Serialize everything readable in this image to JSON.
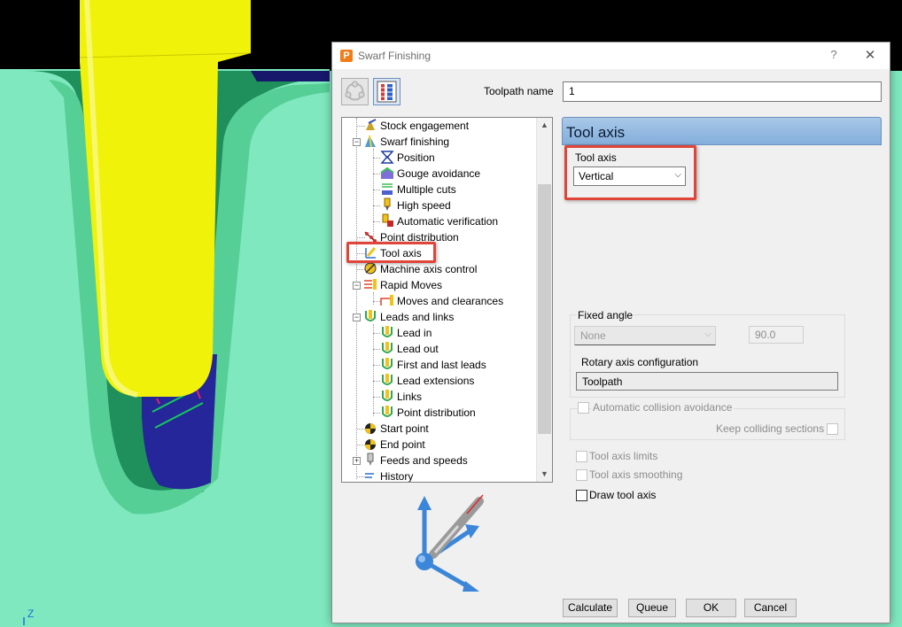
{
  "colors": {
    "viewport_background": "#7fe8bf",
    "tool_yellow": "#f1f20a",
    "cavity_blue": "#25269a",
    "highlight_red": "#e0453a",
    "header_blue": "#8fb5de"
  },
  "viewport": {
    "axis_label": "Z"
  },
  "dialog": {
    "title": "Swarf Finishing",
    "help_label": "?",
    "close_label": "✕",
    "toolpath_name_label": "Toolpath name",
    "toolpath_name_value": "1"
  },
  "tree": [
    {
      "label": "Stock engagement",
      "icon": "stock-engagement-icon"
    },
    {
      "label": "Swarf finishing",
      "icon": "swarf-finishing-icon"
    },
    {
      "label": "Position",
      "icon": "position-icon"
    },
    {
      "label": "Gouge avoidance",
      "icon": "gouge-avoidance-icon"
    },
    {
      "label": "Multiple cuts",
      "icon": "multiple-cuts-icon"
    },
    {
      "label": "High speed",
      "icon": "high-speed-icon"
    },
    {
      "label": "Automatic verification",
      "icon": "automatic-verification-icon"
    },
    {
      "label": "Point distribution",
      "icon": "point-distribution-icon"
    },
    {
      "label": "Tool axis",
      "icon": "tool-axis-icon"
    },
    {
      "label": "Machine axis control",
      "icon": "machine-axis-control-icon"
    },
    {
      "label": "Rapid Moves",
      "icon": "rapid-moves-icon"
    },
    {
      "label": "Moves and clearances",
      "icon": "moves-clearances-icon"
    },
    {
      "label": "Leads and links",
      "icon": "leads-links-icon"
    },
    {
      "label": "Lead in",
      "icon": "lead-in-icon"
    },
    {
      "label": "Lead out",
      "icon": "lead-out-icon"
    },
    {
      "label": "First and last leads",
      "icon": "first-last-leads-icon"
    },
    {
      "label": "Lead extensions",
      "icon": "lead-extensions-icon"
    },
    {
      "label": "Links",
      "icon": "links-icon"
    },
    {
      "label": "Point distribution",
      "icon": "point-distribution-icon"
    },
    {
      "label": "Start point",
      "icon": "start-point-icon"
    },
    {
      "label": "End point",
      "icon": "end-point-icon"
    },
    {
      "label": "Feeds and speeds",
      "icon": "feeds-speeds-icon"
    },
    {
      "label": "History",
      "icon": "history-icon"
    }
  ],
  "panel": {
    "title": "Tool axis",
    "tool_axis_label": "Tool axis",
    "tool_axis_value": "Vertical",
    "fixed_angle_label": "Fixed angle",
    "fixed_angle_value": "None",
    "angle_value": "90.0",
    "rotary_label": "Rotary axis configuration",
    "rotary_value": "Toolpath",
    "auto_collision_label": "Automatic collision avoidance",
    "keep_colliding_label": "Keep colliding sections",
    "tool_axis_limits_label": "Tool axis limits",
    "tool_axis_smoothing_label": "Tool axis smoothing",
    "draw_tool_axis_label": "Draw tool axis"
  },
  "buttons": {
    "calculate": "Calculate",
    "queue": "Queue",
    "ok": "OK",
    "cancel": "Cancel"
  }
}
